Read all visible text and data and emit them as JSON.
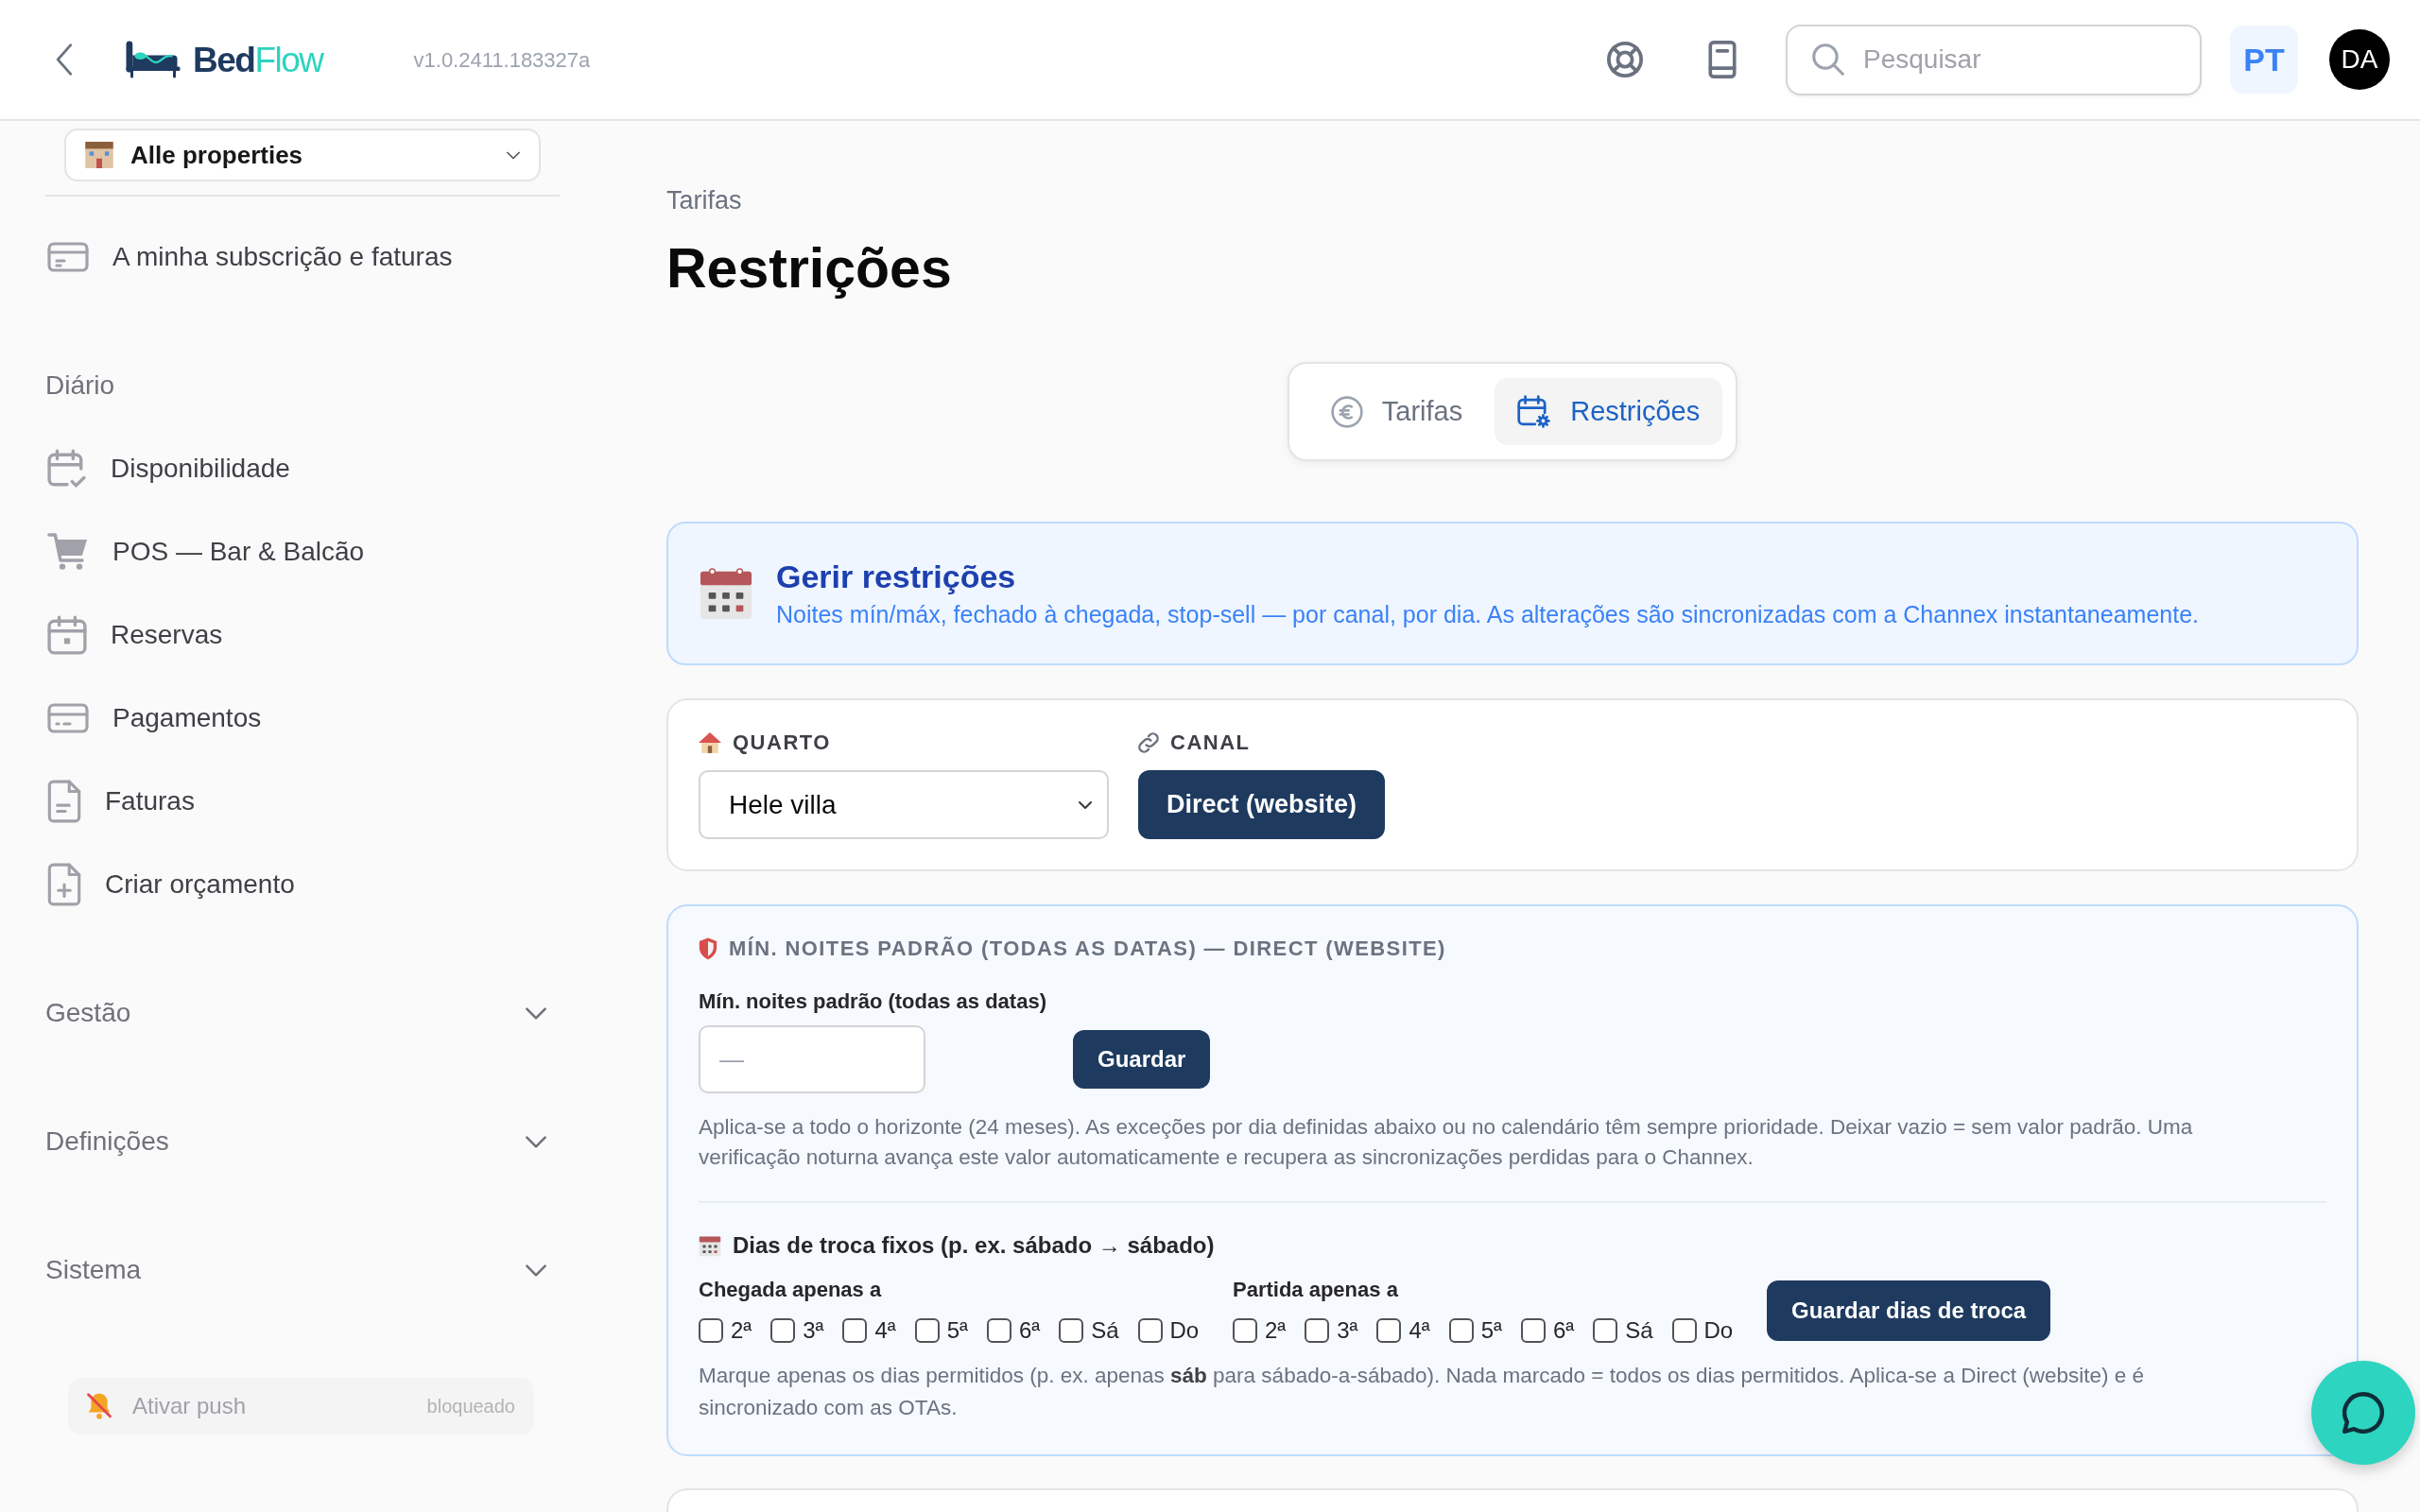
{
  "header": {
    "logo": {
      "part_1": "Bed",
      "part_2": "Flow"
    },
    "version": "v1.0.2411.183327a",
    "search": {
      "placeholder": "Pesquisar"
    },
    "language": "PT",
    "avatar": "DA"
  },
  "sidebar": {
    "property_select": {
      "value": "Alle properties"
    },
    "account_items": [
      {
        "label": "A minha subscrição e faturas"
      }
    ],
    "daily": {
      "title": "Diário",
      "items": [
        {
          "label": "Disponibilidade"
        },
        {
          "label": "POS — Bar & Balcão"
        },
        {
          "label": "Reservas"
        },
        {
          "label": "Pagamentos"
        },
        {
          "label": "Faturas"
        },
        {
          "label": "Criar orçamento"
        }
      ]
    },
    "groups": [
      {
        "title": "Gestão",
        "expanded": false
      },
      {
        "title": "Definições",
        "expanded": false
      },
      {
        "title": "Sistema",
        "expanded": false
      }
    ],
    "push": {
      "label": "Ativar push",
      "status": "bloqueado",
      "disabled": true
    }
  },
  "page": {
    "breadcrumb": "Tarifas",
    "title": "Restrições"
  },
  "tabs": [
    {
      "label": "Tarifas",
      "selected": false
    },
    {
      "label": "Restrições",
      "selected": true
    }
  ],
  "info_banner": {
    "title": "Gerir restrições",
    "text": "Noites mín/máx, fechado à chegada, stop-sell — por canal, por dia. As alterações são sincronizadas com a Channex instantaneamente."
  },
  "filters": {
    "room": {
      "label": "QUARTO",
      "value": "Hele villa"
    },
    "channel": {
      "label": "CANAL",
      "options": [
        {
          "label": "Direct (website)",
          "selected": true
        }
      ]
    }
  },
  "min_nights": {
    "heading": "MÍN. NOITES PADRÃO (TODAS AS DATAS) — DIRECT (WEBSITE)",
    "field_label": "Mín. noites padrão (todas as datas)",
    "placeholder": "—",
    "button": "Guardar",
    "help": "Aplica-se a todo o horizonte (24 meses). As exceções por dia definidas abaixo ou no calendário têm sempre prioridade. Deixar vazio = sem valor padrão. Uma verificação noturna avança este valor automaticamente e recupera as sincronizações perdidas para o Channex."
  },
  "changeover": {
    "title": "Dias de troca fixos (p. ex. sábado → sábado)",
    "arrival": {
      "label": "Chegada apenas a",
      "days": [
        {
          "label": "2ª",
          "checked": false
        },
        {
          "label": "3ª",
          "checked": false
        },
        {
          "label": "4ª",
          "checked": false
        },
        {
          "label": "5ª",
          "checked": false
        },
        {
          "label": "6ª",
          "checked": false
        },
        {
          "label": "Sá",
          "checked": false
        },
        {
          "label": "Do",
          "checked": false
        }
      ]
    },
    "departure": {
      "label": "Partida apenas a",
      "days": [
        {
          "label": "2ª",
          "checked": false
        },
        {
          "label": "3ª",
          "checked": false
        },
        {
          "label": "4ª",
          "checked": false
        },
        {
          "label": "5ª",
          "checked": false
        },
        {
          "label": "6ª",
          "checked": false
        },
        {
          "label": "Sá",
          "checked": false
        },
        {
          "label": "Do",
          "checked": false
        }
      ]
    },
    "button": "Guardar dias de troca",
    "note": "Marque apenas os dias permitidos (p. ex. apenas **sáb** para sábado-a-sábado). Nada marcado = todos os dias permitidos. Aplica-se a Direct (website) e é sincronizado com as OTAs."
  }
}
